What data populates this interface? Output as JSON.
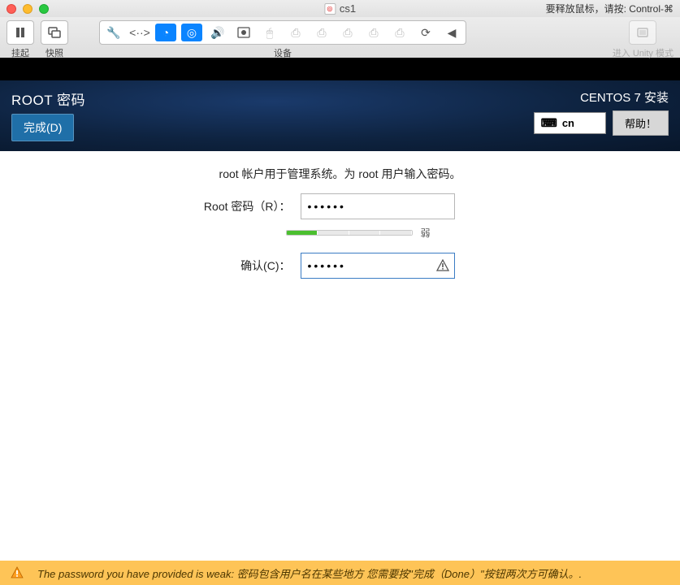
{
  "mac": {
    "title": "cs1",
    "hint": "要释放鼠标，请按: Control-⌘"
  },
  "vm": {
    "pause_label": "挂起",
    "snapshot_label": "快照",
    "devices_label": "设备",
    "unity_label": "进入 Unity 模式"
  },
  "installer": {
    "title": "ROOT 密码",
    "done_label": "完成(D)",
    "subtitle": "CENTOS 7 安装",
    "keyboard_layout": "cn",
    "help_label": "帮助！"
  },
  "body": {
    "desc": "root 帐户用于管理系统。为 root 用户输入密码。",
    "password_label": "Root 密码（R）：",
    "confirm_label": "确认(C)：",
    "password_value": "••••••",
    "confirm_value": "••••••",
    "strength_text": "弱",
    "strength_filled_segments": 1,
    "strength_total_segments": 4
  },
  "warning": {
    "text": "The password you have provided is weak: 密码包含用户名在某些地方 您需要按\"完成（Done）\"按钮两次方可确认。."
  }
}
